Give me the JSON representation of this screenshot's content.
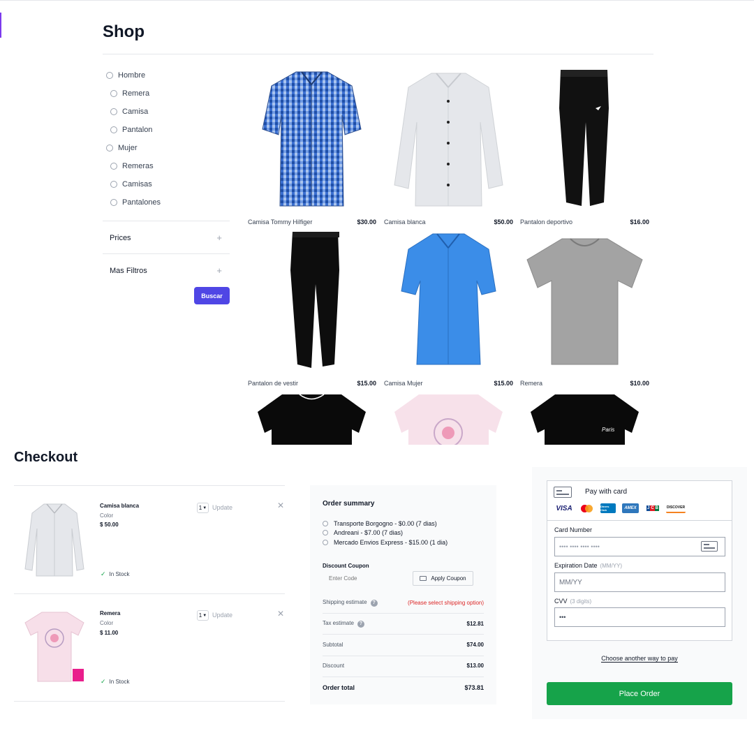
{
  "shop": {
    "title": "Shop",
    "categories": [
      {
        "label": "Hombre",
        "level": 0
      },
      {
        "label": "Remera",
        "level": 1
      },
      {
        "label": "Camisa",
        "level": 1
      },
      {
        "label": "Pantalon",
        "level": 1
      },
      {
        "label": "Mujer",
        "level": 0
      },
      {
        "label": "Remeras",
        "level": 1
      },
      {
        "label": "Camisas",
        "level": 1
      },
      {
        "label": "Pantalones",
        "level": 1
      }
    ],
    "filters": [
      {
        "label": "Prices",
        "icon": "plus-icon"
      },
      {
        "label": "Mas Filtros",
        "icon": "plus-icon"
      }
    ],
    "search_button": "Buscar",
    "products": [
      {
        "name": "Camisa Tommy Hilfiger",
        "price": "$30.00"
      },
      {
        "name": "Camisa blanca",
        "price": "$50.00"
      },
      {
        "name": "Pantalon deportivo",
        "price": "$16.00"
      },
      {
        "name": "Pantalon de vestir",
        "price": "$15.00"
      },
      {
        "name": "Camisa Mujer",
        "price": "$15.00"
      },
      {
        "name": "Remera",
        "price": "$10.00"
      }
    ],
    "partial_product_text": "Paris"
  },
  "checkout": {
    "title": "Checkout",
    "cart": [
      {
        "name": "Camisa blanca",
        "color_label": "Color",
        "price": "$ 50.00",
        "qty": "1",
        "update": "Update",
        "stock": "In Stock"
      },
      {
        "name": "Remera",
        "color_label": "Color",
        "price": "$ 11.00",
        "qty": "1",
        "update": "Update",
        "stock": "In Stock"
      }
    ],
    "summary": {
      "title": "Order summary",
      "shipping_options": [
        "Transporte Borgogno - $0.00 (7 dias)",
        "Andreani - $7.00 (7 dias)",
        "Mercado Envios Express - $15.00 (1 dia)"
      ],
      "coupon_label": "Discount Coupon",
      "coupon_placeholder": "Enter Code",
      "coupon_button": "Apply Coupon",
      "shipping_label": "Shipping estimate",
      "shipping_value": "(Please select shipping option)",
      "tax_label": "Tax estimate",
      "tax_value": "$12.81",
      "subtotal_label": "Subtotal",
      "subtotal_value": "$74.00",
      "discount_label": "Discount",
      "discount_value": "$13.00",
      "total_label": "Order total",
      "total_value": "$73.81"
    },
    "payment": {
      "title": "Pay with card",
      "card_brands": [
        "VISA",
        "mastercard",
        "Diners Club",
        "AMEX",
        "JCB",
        "DISCOVER"
      ],
      "card_number_label": "Card Number",
      "card_number_placeholder": "•••• •••• •••• ••••",
      "expiration_label": "Expiration Date",
      "expiration_hint": "(MM/YY)",
      "expiration_placeholder": "MM/YY",
      "cvv_label": "CVV",
      "cvv_hint": "(3 digits)",
      "cvv_value": "•••",
      "another_way": "Choose another way to pay",
      "place_order": "Place Order"
    },
    "colors": {
      "accent": "#4f46e5",
      "place_order": "#16a34a",
      "warning": "#dc2626"
    }
  }
}
